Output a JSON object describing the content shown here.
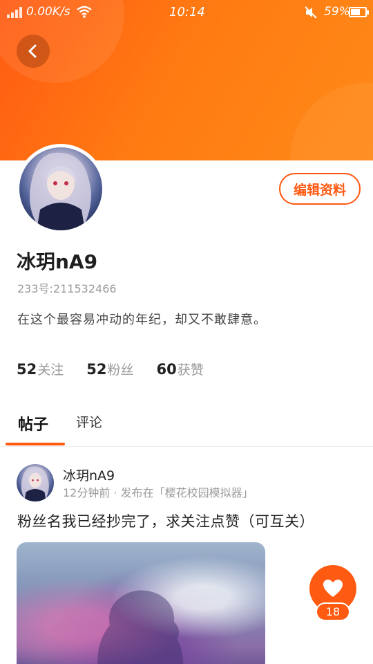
{
  "status_bar": {
    "speed": "0.00K/s",
    "time": "10:14",
    "battery": "59%"
  },
  "profile": {
    "name": "冰玥nA9",
    "uid": "233号:211532466",
    "bio": "在这个最容易冲动的年纪，却又不敢肆意。",
    "edit_label": "编辑资料",
    "stats": [
      {
        "num": "52",
        "label": "关注"
      },
      {
        "num": "52",
        "label": "粉丝"
      },
      {
        "num": "60",
        "label": "获赞"
      }
    ]
  },
  "tabs": [
    {
      "label": "帖子",
      "active": true
    },
    {
      "label": "评论",
      "active": false
    }
  ],
  "post": {
    "author": "冰玥nA9",
    "meta": "12分钟前 · 发布在「樱花校园模拟器」",
    "text": "粉丝名我已经抄完了，求关注点赞（可互关）"
  },
  "like": {
    "count": "18"
  },
  "colors": {
    "accent": "#ff5a12"
  },
  "icons": {
    "back": "chevron-left-icon",
    "wifi": "wifi-icon",
    "mute": "mute-icon",
    "battery": "battery-icon",
    "like": "heart-icon"
  }
}
